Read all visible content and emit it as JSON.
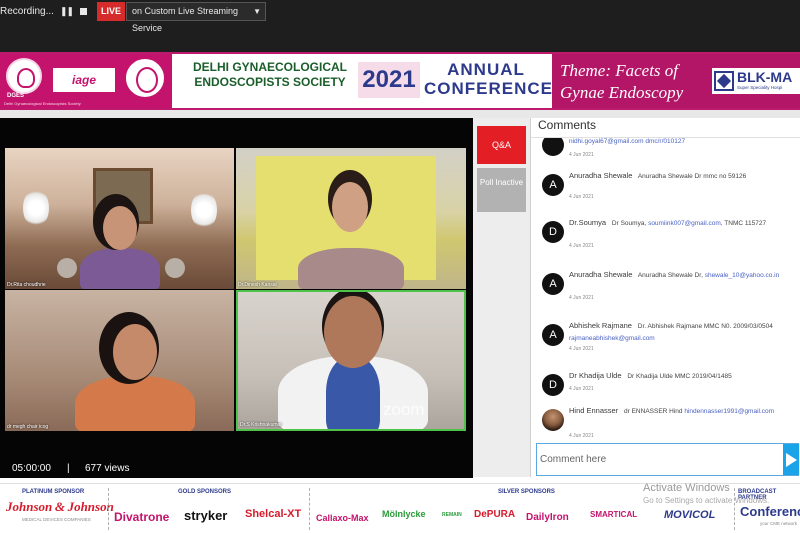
{
  "recording_bar": {
    "status": "Recording...",
    "live_label": "LIVE",
    "stream_service": "on Custom Live Streaming Service"
  },
  "banner": {
    "dges_label": "DGES",
    "dges_sub": "Delhi Gynaecological Endoscopists Society",
    "iage_logo": "iage",
    "society_title": "DELHI GYNAECOLOGICAL ENDOSCOPISTS SOCIETY",
    "year": "2021",
    "conference_title": "ANNUAL CONFERENCE",
    "theme": "Theme: Facets of Gynae Endoscopy",
    "hospital": "BLK-MA",
    "hospital_sub": "Super Speciality Hospi",
    "brand_color": "#c3136c"
  },
  "video": {
    "participants": [
      {
        "name": "Dr.Rita choudhrie"
      },
      {
        "name": "Dr.Dinesh Kansal"
      },
      {
        "name": "dr megh chair icog"
      },
      {
        "name": "Dr.S Krishnakumar"
      }
    ],
    "active_speaker_color": "#4fc24a",
    "watermark": "zoom",
    "timer": "05:00:00",
    "separator": "|",
    "views": "677 views"
  },
  "side_buttons": {
    "qa": "Q&A",
    "poll": "Poll Inactive"
  },
  "comments": {
    "title": "Comments",
    "partial_top": "nidhi.goyal67@gmail.com dmc/r/010127",
    "partial_time": "4 Jun 2021",
    "items": [
      {
        "avatar": "A",
        "name": "Anuradha Shewale",
        "text": "Anuradha Shewale Dr mmc no 59126",
        "email": "",
        "time": "4 Jun 2021"
      },
      {
        "avatar": "D",
        "name": "Dr.Soumya",
        "text": "Dr Soumya,",
        "email": "soumiink007@gmail.com,",
        "text2": "TNMC 115727",
        "time": "4 Jun 2021"
      },
      {
        "avatar": "A",
        "name": "Anuradha Shewale",
        "text": "Anuradha Shewale Dr,",
        "email": "shewale_10@yahoo.co.in",
        "time": "4 Jun 2021"
      },
      {
        "avatar": "A",
        "name": "Abhishek Rajmane",
        "text": "Dr. Abhishek Rajmane MMC N0. 2009/03/0504",
        "email": "rajmaneabhishek@gmail.com",
        "time": "4 Jun 2021"
      },
      {
        "avatar": "D",
        "name": "Dr Khadija Ulde",
        "text": "Dr Khadija Ulde MMC 2019/04/1485",
        "email": "",
        "time": "4 Jun 2021"
      },
      {
        "avatar": "photo",
        "name": "Hind Ennasser",
        "text": "dr ENNASSER Hind",
        "email": "hindennasser1991@gmail.com",
        "time": "4 Jun 2021"
      }
    ],
    "input_placeholder": "Comment here"
  },
  "activate_windows": {
    "title": "Activate Windows",
    "sub": "Go to Settings to activate Windows."
  },
  "sponsors": {
    "platinum_head": "PLATINUM SPONSOR",
    "gold_head": "GOLD SPONSORS",
    "silver_head": "SILVER SPONSORS",
    "broadcast_head": "BROADCAST PARTNER",
    "jnj": "Johnson & Johnson",
    "jnj_sub": "MEDICAL DEVICES COMPANIES",
    "gold": [
      "Divatrone",
      "stryker",
      "Shelcal-XT"
    ],
    "silver": [
      "Callaxo-Max",
      "Mölnlycke",
      "REMAIN",
      "DePURA",
      "DailyIron",
      "SMARTICAL",
      "MOVICOL"
    ],
    "broadcast": "Conference",
    "broadcast_sub": "your CME network"
  }
}
